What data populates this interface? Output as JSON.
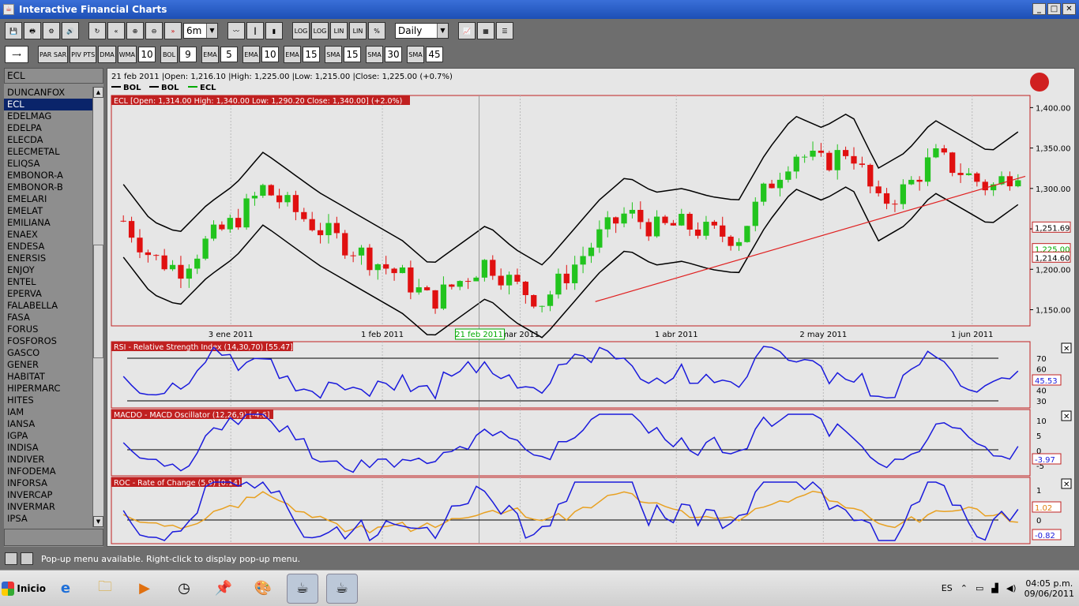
{
  "window": {
    "title": "Interactive Financial Charts"
  },
  "toolbar1": {
    "period": "6m",
    "interval": "Daily",
    "buttons": [
      "LOG",
      "LOG",
      "LIN",
      "LIN",
      "%"
    ]
  },
  "toolbar2": {
    "items": [
      {
        "label": "PAR SAR",
        "value": ""
      },
      {
        "label": "PIV PTS",
        "value": ""
      },
      {
        "label": "DMA",
        "value": ""
      },
      {
        "label": "WMA",
        "value": "10"
      },
      {
        "label": "BOL",
        "value": "9"
      },
      {
        "label": "EMA",
        "value": "5"
      },
      {
        "label": "EMA",
        "value": "10"
      },
      {
        "label": "EMA",
        "value": "15"
      },
      {
        "label": "SMA",
        "value": "15"
      },
      {
        "label": "SMA",
        "value": "30"
      },
      {
        "label": "SMA",
        "value": "45"
      }
    ]
  },
  "sidebar": {
    "search_value": "ECL",
    "active": "ECL",
    "items": [
      "DUNCANFOX",
      "ECL",
      "EDELMAG",
      "EDELPA",
      "ELECDA",
      "ELECMETAL",
      "ELIQSA",
      "EMBONOR-A",
      "EMBONOR-B",
      "EMELARI",
      "EMELAT",
      "EMILIANA",
      "ENAEX",
      "ENDESA",
      "ENERSIS",
      "ENJOY",
      "ENTEL",
      "EPERVA",
      "FALABELLA",
      "FASA",
      "FORUS",
      "FOSFOROS",
      "GASCO",
      "GENER",
      "HABITAT",
      "HIPERMARC",
      "HITES",
      "IAM",
      "IANSA",
      "IGPA",
      "INDISA",
      "INDIVER",
      "INFODEMA",
      "INFORSA",
      "INVERCAP",
      "INVERMAR",
      "IPSA"
    ]
  },
  "chart": {
    "info_line": "21 feb 2011 |Open: 1,216.10 |High: 1,225.00 |Low: 1,215.00 |Close: 1,225.00 (+0.7%)",
    "legend": [
      "BOL",
      "BOL",
      "ECL"
    ],
    "price_header": "ECL [Open: 1,314.00  High: 1,340.00  Low: 1,290.20  Close: 1,340.00] (+2.0%)",
    "price_ticks": [
      "1,400.00",
      "1,350.00",
      "1,300.00",
      "1,250.00",
      "1,200.00",
      "1,150.00"
    ],
    "price_tick_values": [
      1400,
      1350,
      1300,
      1250,
      1200,
      1150
    ],
    "price_labels": [
      {
        "text": "1,251.69",
        "value": 1251.69,
        "color": "#000"
      },
      {
        "text": "1,225.00",
        "value": 1225,
        "color": "#0a0"
      },
      {
        "text": "1,214.60",
        "value": 1214.6,
        "color": "#000"
      }
    ],
    "date_labels": [
      {
        "text": "3 ene 2011",
        "frac": 0.13
      },
      {
        "text": "1 feb 2011",
        "frac": 0.295
      },
      {
        "text": "mar 2011",
        "frac": 0.445
      },
      {
        "text": "1 abr 2011",
        "frac": 0.615
      },
      {
        "text": "2 may 2011",
        "frac": 0.775
      },
      {
        "text": "1 jun 2011",
        "frac": 0.937
      }
    ],
    "cursor_date": "21 feb 2011",
    "rsi_header": "RSI - Relative Strength Index (14,30,70) [55.47]",
    "rsi_ticks": [
      "70",
      "60",
      "50",
      "40",
      "30"
    ],
    "rsi_value": "45.53",
    "macd_header": "MACDO - MACD Oscillator (12,26,9) [-4.6]",
    "macd_ticks": [
      "10",
      "5",
      "0",
      "-5"
    ],
    "macd_value": "-3.97",
    "roc_header": "ROC - Rate of Change (5,9) [0.14]",
    "roc_ticks": [
      "1",
      "0.5",
      "0"
    ],
    "roc_values": [
      "1.02",
      "-0.82"
    ],
    "colors": {
      "up": "#22c41e",
      "down": "#e01010",
      "line": "#1a1adc",
      "panel_border": "#c02020",
      "trend": "#e02020"
    }
  },
  "status": {
    "text": "Pop-up menu available. Right-click to display pop-up menu."
  },
  "taskbar": {
    "start_label": "Inicio",
    "lang": "ES",
    "time": "04:05 p.m.",
    "date": "09/06/2011"
  }
}
